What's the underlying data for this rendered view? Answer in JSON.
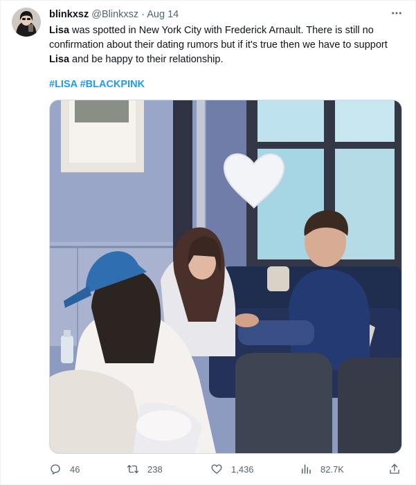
{
  "tweet": {
    "display_name": "blinkxsz",
    "handle": "@Blinkxsz",
    "separator": "·",
    "timestamp": "Aug 14",
    "text_parts": {
      "p1_bold": "Lisa",
      "p2": " was spotted in New York City with Frederick Arnault. There is still no confirmation about their dating rumors but if it's true then we have to support ",
      "p3_bold": "Lisa",
      "p4": " and be happy to their relationship."
    },
    "hashtags": [
      "#LISA",
      "#BLACKPINK"
    ]
  },
  "actions": {
    "replies": "46",
    "retweets": "238",
    "likes": "1,436",
    "views": "82.7K"
  },
  "icons": {
    "more": "more-horizontal-icon",
    "reply": "reply-icon",
    "retweet": "retweet-icon",
    "like": "heart-icon",
    "views": "views-chart-icon",
    "share": "share-icon"
  },
  "colors": {
    "text": "#0f1419",
    "muted": "#536471",
    "link": "#1d9bf0",
    "border": "#cfd9de"
  }
}
